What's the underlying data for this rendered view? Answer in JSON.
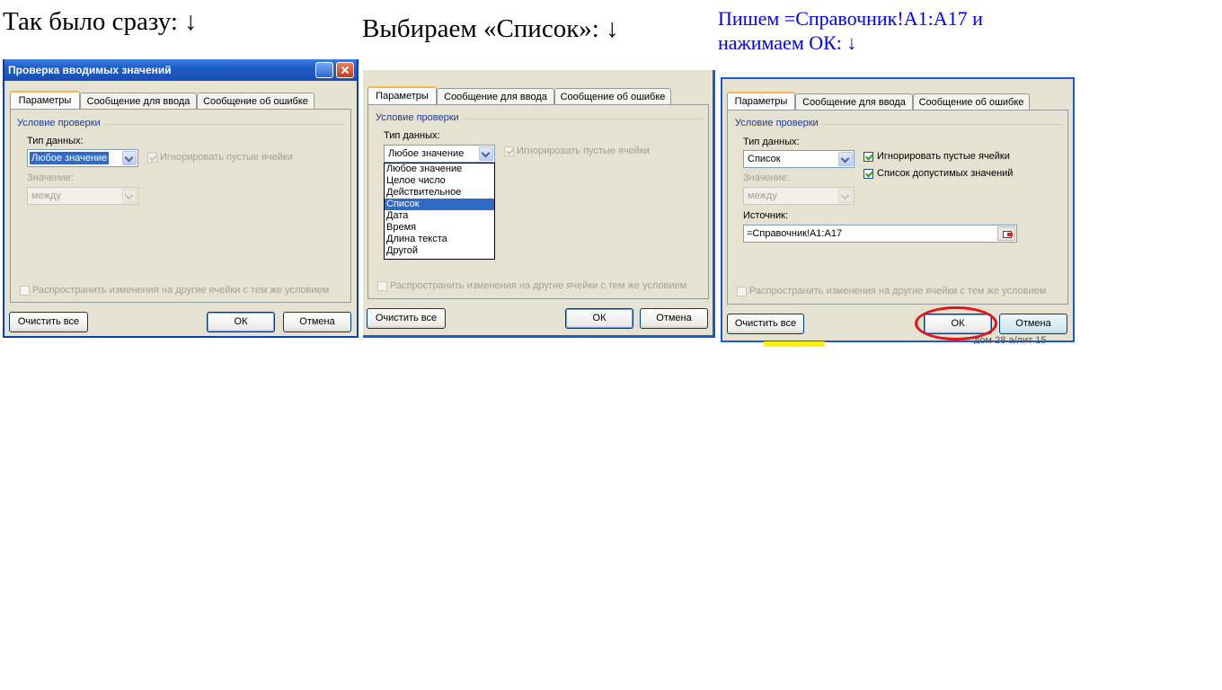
{
  "captions": {
    "left": "Так было сразу: ↓",
    "middle": "Выбираем «Список»: ↓",
    "right_line1": "Пишем =Справочник!А1:А17 и",
    "right_line2": "нажимаем ОК: ↓"
  },
  "dialog": {
    "title": "Проверка вводимых значений",
    "tabs": [
      "Параметры",
      "Сообщение для ввода",
      "Сообщение об ошибке"
    ],
    "group_label": "Условие проверки",
    "data_type_label": "Тип данных:",
    "value_label": "Значение:",
    "source_label": "Источник:",
    "ignore_blank_label": "Игнорировать пустые ячейки",
    "in_cell_dropdown_label": "Список допустимых значений",
    "spread_changes_label": "Распространить изменения на другие ячейки с тем же условием",
    "clear_all_button": "Очистить все",
    "ok_button": "ОК",
    "cancel_button": "Отмена"
  },
  "panel1": {
    "data_type": "Любое значение",
    "value": "между"
  },
  "panel2": {
    "data_type": "Любое значение",
    "options": [
      "Любое значение",
      "Целое число",
      "Действительное",
      "Список",
      "Дата",
      "Время",
      "Длина текста",
      "Другой"
    ],
    "selected_option": "Список"
  },
  "panel3": {
    "data_type": "Список",
    "value": "между",
    "source": "=Справочник!A1:A17",
    "background_snippet": "дом 28 а/лит 15"
  },
  "colors": {
    "highlight_oval": "#e3121b",
    "caption_blue": "#0000ff",
    "selection": "#316ac5"
  }
}
